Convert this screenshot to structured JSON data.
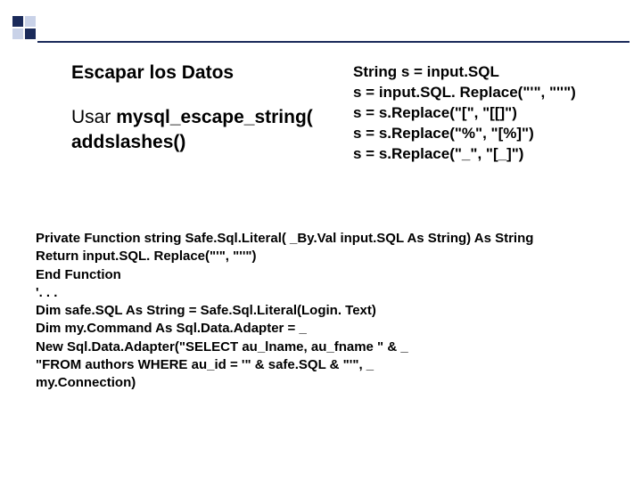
{
  "decoration": {
    "squares": [
      "dark",
      "light",
      "light",
      "dark"
    ]
  },
  "content": {
    "heading": "Escapar los Datos",
    "line1_pre": "Usar ",
    "line1_bold": "mysql_escape_string(",
    "line2": "addslashes()"
  },
  "codebox1": {
    "l1": "String  s = input.SQL",
    "l2": "s = input.SQL. Replace(\"'\", \"''\")",
    "l3": "s = s.Replace(\"[\", \"[[]\")",
    "l4": "s = s.Replace(\"%\", \"[%]\")",
    "l5": "s = s.Replace(\"_\", \"[_]\")"
  },
  "codebox2": {
    "l1": "Private Function string Safe.Sql.Literal( _By.Val input.SQL As String) As String",
    "l2": "Return input.SQL. Replace(\"'\", \"''\")",
    "l3": "End Function",
    "l4": "'. . .",
    "l5": "Dim safe.SQL As String = Safe.Sql.Literal(Login. Text)",
    "l6": "Dim my.Command As Sql.Data.Adapter = _",
    "l7": "New Sql.Data.Adapter(\"SELECT au_lname, au_fname \" & _",
    "l8": "\"FROM authors WHERE au_id = '\" & safe.SQL & \"'\", _",
    "l9": "my.Connection)"
  }
}
